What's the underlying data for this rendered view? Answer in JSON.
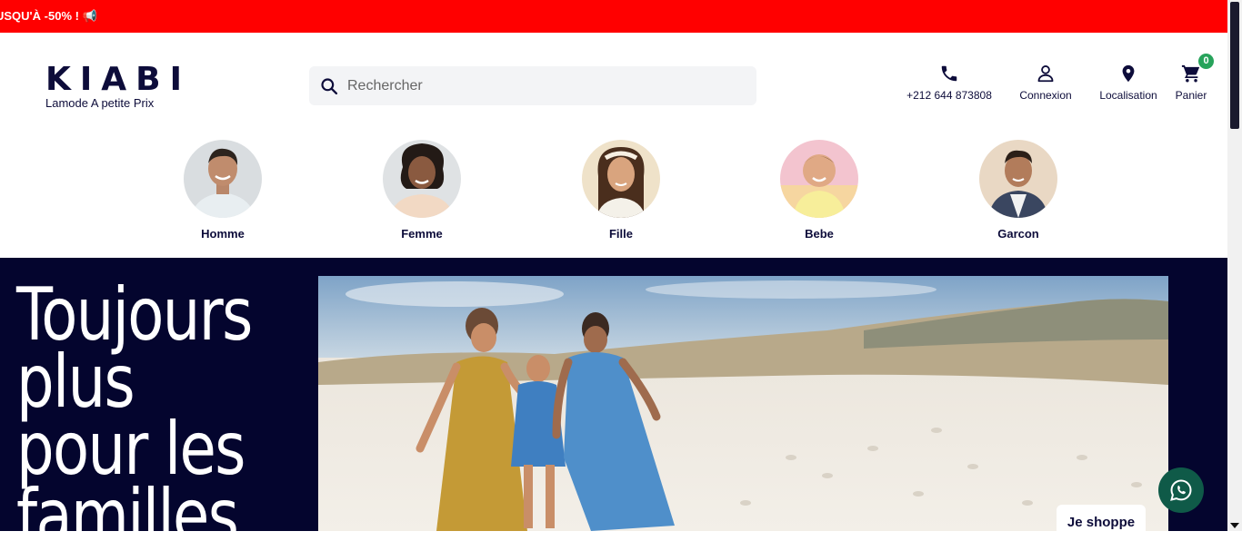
{
  "promo": {
    "text": "USQU'À -50% ! 📢"
  },
  "header": {
    "brand": "KIABI",
    "tagline": "Lamode A petite Prix",
    "search": {
      "placeholder": "Rechercher"
    },
    "actions": {
      "phone": "+212 644 873808",
      "login": "Connexion",
      "location": "Localisation",
      "cart": "Panier",
      "cart_count": "0"
    }
  },
  "categories": [
    {
      "label": "Homme"
    },
    {
      "label": "Femme"
    },
    {
      "label": "Fille"
    },
    {
      "label": "Bebe"
    },
    {
      "label": "Garcon"
    }
  ],
  "hero": {
    "headline": "Toujours plus pour les familles",
    "cta": "Je shoppe"
  },
  "colors": {
    "promo_bg": "#ff0000",
    "navy": "#0d0c3a",
    "hero_bg": "#04052e",
    "badge_green": "#27a35b",
    "whatsapp_green": "#0f5a48"
  },
  "icons": [
    "search-icon",
    "phone-icon",
    "user-icon",
    "location-pin-icon",
    "cart-icon",
    "whatsapp-icon"
  ]
}
